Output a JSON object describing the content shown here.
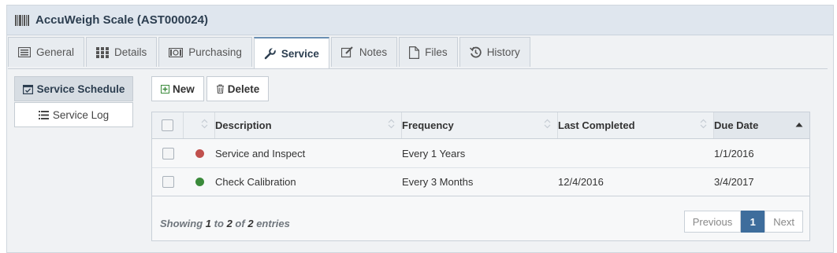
{
  "window": {
    "title": "AccuWeigh Scale (AST000024)"
  },
  "tabs": [
    {
      "label": "General",
      "icon": "list-alt-icon"
    },
    {
      "label": "Details",
      "icon": "grid-icon"
    },
    {
      "label": "Purchasing",
      "icon": "money-icon"
    },
    {
      "label": "Service",
      "icon": "wrench-icon",
      "active": true
    },
    {
      "label": "Notes",
      "icon": "edit-icon"
    },
    {
      "label": "Files",
      "icon": "file-icon"
    },
    {
      "label": "History",
      "icon": "history-icon"
    }
  ],
  "side_nav": {
    "schedule_label": "Service Schedule",
    "log_label": "Service Log"
  },
  "toolbar": {
    "new_label": "New",
    "delete_label": "Delete"
  },
  "table": {
    "columns": [
      "Description",
      "Frequency",
      "Last Completed",
      "Due Date"
    ],
    "sorted_column": "Due Date",
    "rows": [
      {
        "status_color": "#c0504d",
        "description": "Service and Inspect",
        "frequency": "Every 1 Years",
        "last_completed": "",
        "due_date": "1/1/2016"
      },
      {
        "status_color": "#3a8a3a",
        "description": "Check Calibration",
        "frequency": "Every 3 Months",
        "last_completed": "12/4/2016",
        "due_date": "3/4/2017"
      }
    ]
  },
  "footer": {
    "showing_prefix": "Showing",
    "from": "1",
    "to_word": "to",
    "to": "2",
    "of_word": "of",
    "total": "2",
    "entries_word": "entries"
  },
  "pagination": {
    "previous_label": "Previous",
    "current_page": "1",
    "next_label": "Next"
  },
  "colors": {
    "accent": "#3e6d9c",
    "title_bar": "#dfe6ee"
  }
}
